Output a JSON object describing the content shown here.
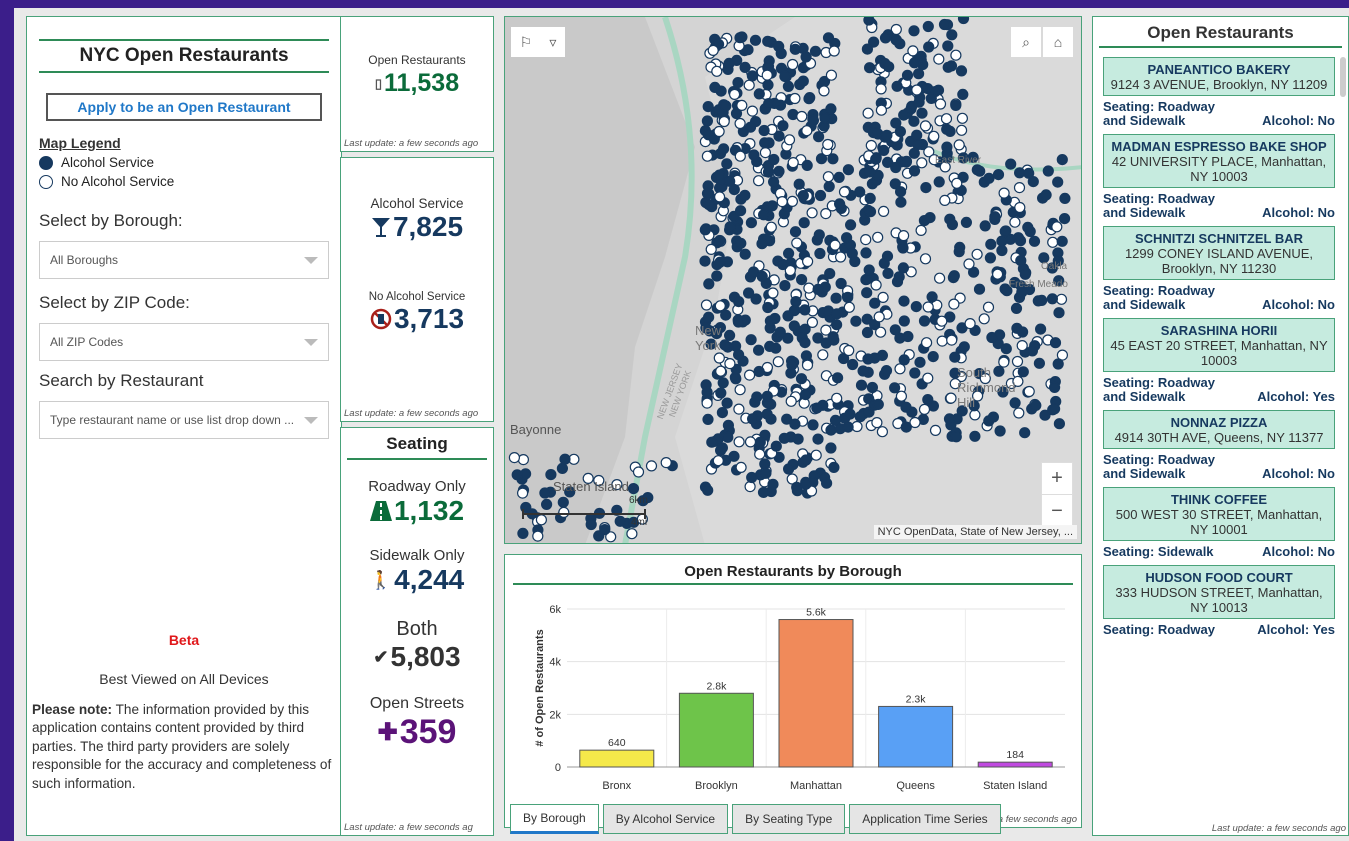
{
  "left": {
    "title": "NYC Open Restaurants",
    "apply_button": "Apply to be an Open Restaurant",
    "legend_title": "Map Legend",
    "legend": [
      "Alcohol Service",
      "No Alcohol Service"
    ],
    "borough_label": "Select by Borough:",
    "borough_value": "All Boroughs",
    "zip_label": "Select by ZIP Code:",
    "zip_value": "All ZIP Codes",
    "search_label": "Search by Restaurant",
    "search_placeholder": "Type restaurant name or use list drop down ...",
    "beta": "Beta",
    "best_viewed": "Best  Viewed on All Devices",
    "note_bold": "Please note:",
    "note_text": " The information provided by this application contains content provided by third parties. The third party providers are solely responsible for the accuracy and completeness of such information."
  },
  "stats": {
    "open_label": "Open Restaurants",
    "open_value": "11,538",
    "alcohol_label": "Alcohol Service",
    "alcohol_value": "7,825",
    "no_alcohol_label": "No Alcohol Service",
    "no_alcohol_value": "3,713",
    "update_text": "Last update: a few seconds ago"
  },
  "seating": {
    "title": "Seating",
    "items": [
      {
        "label": "Roadway Only",
        "value": "1,132"
      },
      {
        "label": "Sidewalk Only",
        "value": "4,244"
      },
      {
        "label": "Both",
        "value": "5,803"
      },
      {
        "label": "Open Streets",
        "value": "359"
      }
    ],
    "update_text": "Last update: a few seconds ag"
  },
  "map": {
    "labels": [
      "East River",
      "Bayonne",
      "Staten Island",
      "NEW JERSEY",
      "NEW YORK",
      "Oakla",
      "Fresh Meado",
      "South Richmond Hill",
      "New York"
    ],
    "scale_km": "6km",
    "scale_mi": "4mi",
    "attribution": "NYC OpenData, State of New Jersey, ..."
  },
  "chart": {
    "title": "Open Restaurants by Borough",
    "update_text": "Last update: a few seconds ago"
  },
  "chart_data": {
    "type": "bar",
    "categories": [
      "Bronx",
      "Brooklyn",
      "Manhattan",
      "Queens",
      "Staten Island"
    ],
    "values": [
      640,
      2800,
      5600,
      2300,
      184
    ],
    "data_labels": [
      "640",
      "2.8k",
      "5.6k",
      "2.3k",
      "184"
    ],
    "colors": [
      "#f5e94a",
      "#6ec44a",
      "#f08a5a",
      "#59a0f5",
      "#c04ae0"
    ],
    "ylabel": "# of Open Restaurants",
    "ylim": [
      0,
      6000
    ],
    "yticks": [
      {
        "v": 0,
        "t": "0"
      },
      {
        "v": 2000,
        "t": "2k"
      },
      {
        "v": 4000,
        "t": "4k"
      },
      {
        "v": 6000,
        "t": "6k"
      }
    ],
    "grid": true
  },
  "tabs": [
    "By Borough",
    "By Alcohol Service",
    "By Seating Type",
    "Application Time Series"
  ],
  "right": {
    "title": "Open Restaurants",
    "restaurants": [
      {
        "name": "PANEANTICO BAKERY",
        "address": "9124 3 AVENUE, Brooklyn, NY 11209",
        "seating": "Seating:  Roadway and Sidewalk",
        "alcohol": "Alcohol:  No"
      },
      {
        "name": "MADMAN ESPRESSO BAKE SHOP",
        "address": "42 UNIVERSITY PLACE, Manhattan, NY 10003",
        "seating": "Seating:  Roadway and Sidewalk",
        "alcohol": "Alcohol:  No"
      },
      {
        "name": "SCHNITZI SCHNITZEL BAR",
        "address": "1299 CONEY ISLAND AVENUE, Brooklyn, NY 11230",
        "seating": "Seating:  Roadway and Sidewalk",
        "alcohol": "Alcohol:  No"
      },
      {
        "name": "SARASHINA HORII",
        "address": "45 EAST 20 STREET, Manhattan, NY 10003",
        "seating": "Seating:  Roadway and Sidewalk",
        "alcohol": "Alcohol:  Yes"
      },
      {
        "name": "NONNAZ PIZZA",
        "address": "4914 30TH AVE, Queens, NY 11377",
        "seating": "Seating:  Roadway and Sidewalk",
        "alcohol": "Alcohol:  No"
      },
      {
        "name": "THINK COFFEE",
        "address": "500 WEST 30 STREET, Manhattan, NY 10001",
        "seating": "Seating:  Sidewalk",
        "alcohol": "Alcohol:  No"
      },
      {
        "name": "HUDSON FOOD COURT",
        "address": "333 HUDSON STREET, Manhattan, NY 10013",
        "seating": "Seating:  Roadway",
        "alcohol": "Alcohol:  Yes"
      }
    ],
    "update_text": "Last update: a few seconds ago"
  },
  "colors": {
    "green": "#0b6b3a",
    "navy": "#16395f",
    "purple": "#5b1378",
    "accent": "#49a27a"
  }
}
